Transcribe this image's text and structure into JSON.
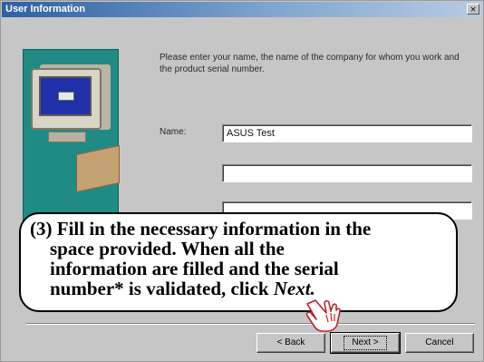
{
  "window": {
    "title": "User Information",
    "close_glyph": "×"
  },
  "intro_text": "Please enter your name, the name of the company for whom you work and the product serial number.",
  "fields": {
    "name": {
      "label": "Name:",
      "value": "ASUS Test"
    },
    "company": {
      "label": "",
      "value": ""
    },
    "serial": {
      "label": "",
      "value": ""
    }
  },
  "callout": {
    "line1": "(3) Fill in the necessary information in the",
    "line2": "space provided. When all the",
    "line3": "information are filled and the serial",
    "line4_pre": "number* is validated, click ",
    "line4_next": "Next."
  },
  "buttons": {
    "back": "< Back",
    "next": "Next >",
    "cancel": "Cancel"
  },
  "colors": {
    "title_bar": "#2d5fa3",
    "art_panel": "#1f8b84",
    "dialog_bg": "#c6c6c6"
  },
  "icons": {
    "pointer": "hand-pointer-icon",
    "illustration": "computer-illustration-icon"
  }
}
